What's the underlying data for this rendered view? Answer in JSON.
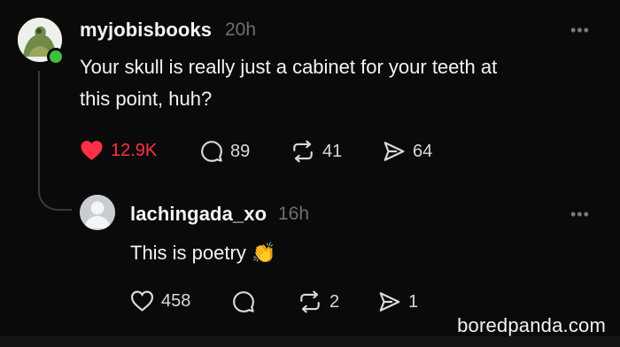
{
  "post": {
    "username": "myjobisbooks",
    "time": "20h",
    "text_line1": "Your skull is really just a cabinet for your teeth at",
    "text_line2": "this point, huh?",
    "more": "•••",
    "likes": "12.9K",
    "replies": "89",
    "reposts": "41",
    "shares": "64"
  },
  "reply": {
    "username": "lachingada_xo",
    "time": "16h",
    "text": "This is poetry",
    "emoji": "👏",
    "more": "•••",
    "likes": "458",
    "replies": "",
    "reposts": "2",
    "shares": "1"
  },
  "watermark": "boredpanda.com",
  "colors": {
    "like_red": "#ff3046",
    "online_green": "#3fbf3f",
    "background": "#0a0a0a"
  }
}
